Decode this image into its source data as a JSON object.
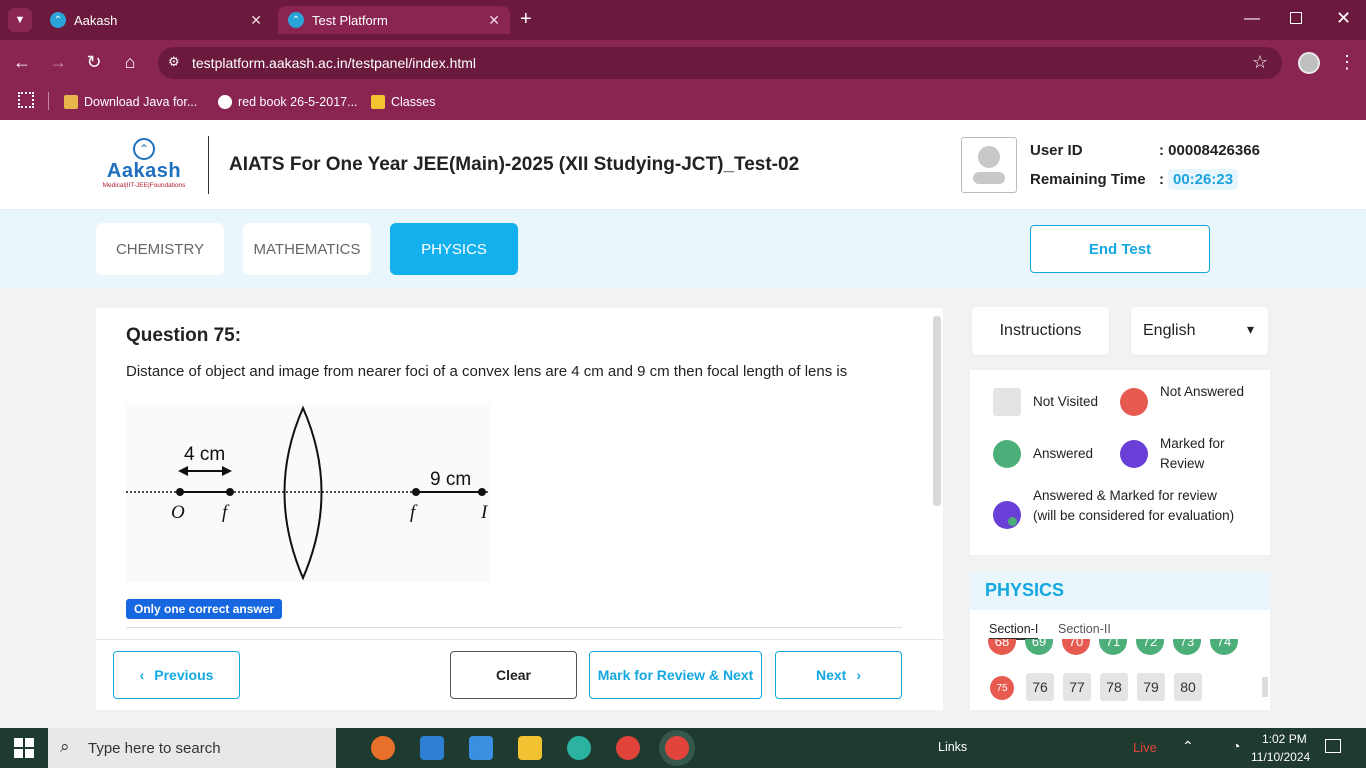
{
  "browser": {
    "tabs": [
      {
        "label": "Aakash"
      },
      {
        "label": "Test Platform"
      }
    ],
    "url": "testplatform.aakash.ac.in/testpanel/index.html",
    "bookmarks": [
      {
        "label": "Download Java for..."
      },
      {
        "label": "red book 26-5-2017..."
      },
      {
        "label": "Classes"
      }
    ]
  },
  "header": {
    "logo_text": "Aakash",
    "logo_tagline": "Medical|IIT-JEE|Foundations",
    "test_title": "AIATS For One Year JEE(Main)-2025 (XII Studying-JCT)_Test-02",
    "user_id_label": "User ID",
    "user_id_value": ": 00008426366",
    "remaining_label": "Remaining Time",
    "remaining_colon": ":",
    "remaining_value": "00:26:23"
  },
  "subjects": [
    {
      "label": "CHEMISTRY",
      "active": false
    },
    {
      "label": "MATHEMATICS",
      "active": false
    },
    {
      "label": "PHYSICS",
      "active": true
    }
  ],
  "end_test_label": "End Test",
  "question": {
    "title": "Question 75:",
    "text": "Distance of object and image from nearer foci of a convex lens are 4 cm and 9 cm then focal length of lens is",
    "figure": {
      "left_dist": "4 cm",
      "right_dist": "9 cm",
      "labels": [
        "O",
        "f",
        "f",
        "I"
      ]
    },
    "badge": "Only one correct answer"
  },
  "actions": {
    "previous": "Previous",
    "clear": "Clear",
    "mark_review": "Mark for Review & Next",
    "next": "Next"
  },
  "panel": {
    "instructions": "Instructions",
    "language": "English",
    "legend": {
      "not_visited": "Not Visited",
      "not_answered": "Not Answered",
      "answered": "Answered",
      "marked": "Marked for Review",
      "answered_marked": "Answered & Marked for review (will be considered for evaluation)"
    },
    "palette_title": "PHYSICS",
    "sections": [
      "Section-I",
      "Section-II"
    ],
    "row1": [
      "68",
      "69",
      "70",
      "71",
      "72",
      "73",
      "74"
    ],
    "row2": [
      "75",
      "76",
      "77",
      "78",
      "79",
      "80"
    ]
  },
  "taskbar": {
    "search_placeholder": "Type here to search",
    "links_label": "Links",
    "live_label": "Live",
    "time": "1:02 PM",
    "date": "11/10/2024"
  },
  "colors": {
    "accent": "#14a8e0",
    "answered": "#4caf7a",
    "not_answered": "#e65a50",
    "marked": "#6a3fd8",
    "browser_frame": "#8a2450"
  }
}
